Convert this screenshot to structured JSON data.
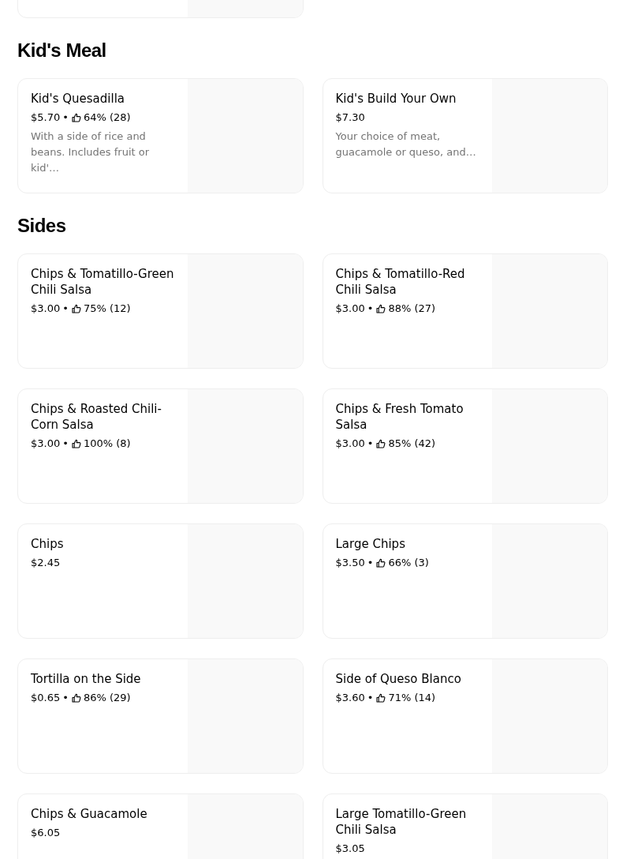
{
  "sections": [
    {
      "title": "Kid's Meal",
      "items": [
        {
          "name": "Kid's Quesadilla",
          "price": "$5.70",
          "separator": "•",
          "rating": "64% (28)",
          "description": "With a side of rice and beans. Includes fruit or kid'…"
        },
        {
          "name": "Kid's Build Your Own",
          "price": "$7.30",
          "description": "Your choice of meat, guacamole or queso, and…"
        }
      ]
    },
    {
      "title": "Sides",
      "items": [
        {
          "name": "Chips & Tomatillo-Green Chili Salsa",
          "price": "$3.00",
          "separator": "•",
          "rating": "75% (12)"
        },
        {
          "name": "Chips & Tomatillo-Red Chili Salsa",
          "price": "$3.00",
          "separator": "•",
          "rating": "88% (27)"
        },
        {
          "name": "Chips & Roasted Chili-Corn Salsa",
          "price": "$3.00",
          "separator": "•",
          "rating": "100% (8)"
        },
        {
          "name": "Chips & Fresh Tomato Salsa",
          "price": "$3.00",
          "separator": "•",
          "rating": "85% (42)"
        },
        {
          "name": "Chips",
          "price": "$2.45"
        },
        {
          "name": "Large Chips",
          "price": "$3.50",
          "separator": "•",
          "rating": "66% (3)"
        },
        {
          "name": "Tortilla on the Side",
          "price": "$0.65",
          "separator": "•",
          "rating": "86% (29)"
        },
        {
          "name": "Side of Queso Blanco",
          "price": "$3.60",
          "separator": "•",
          "rating": "71% (14)"
        },
        {
          "name": "Chips & Guacamole",
          "price": "$6.05"
        },
        {
          "name": "Large Tomatillo-Green Chili Salsa",
          "price": "$3.05"
        }
      ]
    }
  ]
}
